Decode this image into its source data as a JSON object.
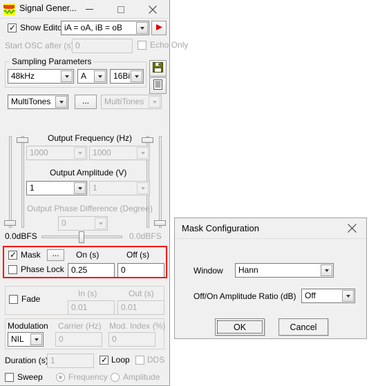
{
  "main_window": {
    "title": "Signal Gener...",
    "app_icon": "signal-wave-icon",
    "buttons": {
      "minimize": "—",
      "maximize": "☐",
      "close": "✕"
    },
    "show_editor": {
      "label": "Show Editor",
      "checked": true,
      "routing_value": "iA = oA, iB = oB"
    },
    "play_button": "play-icon",
    "start_osc": {
      "label": "Start OSC after (s)",
      "value": "0",
      "enabled": false
    },
    "echo_only": {
      "label": "Echo Only",
      "checked": false,
      "enabled": false
    },
    "sampling": {
      "group_title": "Sampling Parameters",
      "rate": "48kHz",
      "channel": "A",
      "bitdepth": "16Bit",
      "save_icon": "floppy-save-icon",
      "list_icon": "score-list-icon"
    },
    "waveform": {
      "primary": "MultiTones",
      "browse_label": "...",
      "secondary": "MultiTones",
      "secondary_enabled": false
    },
    "output_frequency": {
      "label": "Output Frequency (Hz)",
      "left": "1000",
      "right": "1000",
      "enabled": false
    },
    "output_amplitude": {
      "label": "Output Amplitude (V)",
      "left": "1",
      "right": "1"
    },
    "output_phase": {
      "label": "Output Phase Difference (Degree)",
      "value": "0",
      "enabled": false
    },
    "dbfs_left": "0.0dBFS",
    "dbfs_right": "0.0dBFS",
    "mask_section": {
      "mask": {
        "label": "Mask",
        "checked": true
      },
      "config_button": "...",
      "phase_lock": {
        "label": "Phase Lock",
        "checked": false
      },
      "on_label": "On (s)",
      "off_label": "Off (s)",
      "on_value": "0.25",
      "off_value": "0",
      "highlight_color": "#ff0000"
    },
    "fade_section": {
      "fade": {
        "label": "Fade",
        "checked": false
      },
      "in_label": "In (s)",
      "out_label": "Out (s)",
      "in_value": "0.01",
      "out_value": "0.01"
    },
    "modulation_section": {
      "label": "Modulation",
      "type": "NIL",
      "carrier_label": "Carrier (Hz)",
      "carrier_value": "0",
      "mod_index_label": "Mod. Index (%)",
      "mod_index_value": "0"
    },
    "duration_section": {
      "label": "Duration (s)",
      "value": "1",
      "loop": {
        "label": "Loop",
        "checked": true
      },
      "dds": {
        "label": "DDS",
        "checked": false,
        "enabled": false
      }
    },
    "sweep_section": {
      "sweep": {
        "label": "Sweep",
        "checked": false
      },
      "frequency": {
        "label": "Frequency",
        "selected": true,
        "enabled": false
      },
      "amplitude": {
        "label": "Amplitude",
        "selected": false,
        "enabled": false
      }
    }
  },
  "dialog": {
    "title": "Mask Configuration",
    "close_icon": "✕",
    "window_label": "Window",
    "window_value": "Hann",
    "ratio_label": "Off/On Amplitude Ratio (dB)",
    "ratio_value": "Off",
    "ok_label": "OK",
    "cancel_label": "Cancel"
  }
}
